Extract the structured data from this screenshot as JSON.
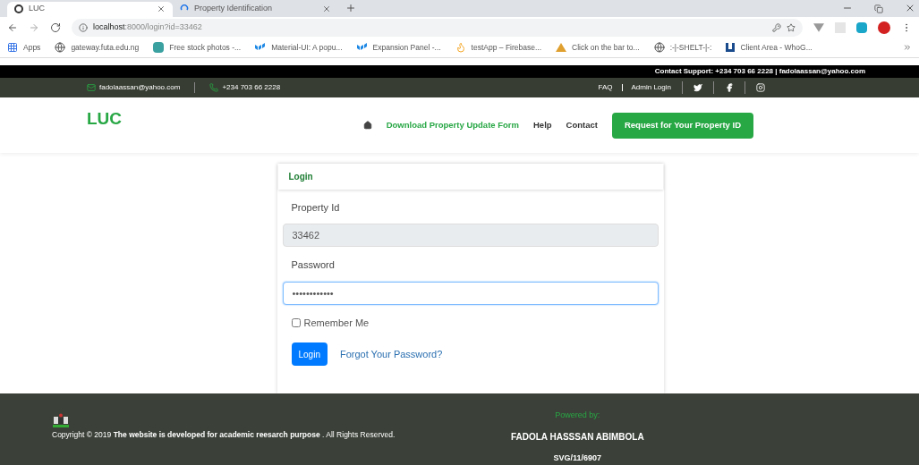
{
  "browser": {
    "tabs": [
      {
        "title": "LUC",
        "selected": true,
        "kind": "loaded"
      },
      {
        "title": "Property Identification",
        "selected": false,
        "kind": "loading"
      }
    ],
    "address": {
      "host": "localhost",
      "rest": ":8000/login?id=33462"
    },
    "bookmarks": [
      {
        "label": "Apps",
        "kind": "apps"
      },
      {
        "label": "gateway.futa.edu.ng",
        "kind": "globe"
      },
      {
        "label": "Free stock photos -...",
        "kind": "square"
      },
      {
        "label": "Material-UI: A popu...",
        "kind": "mui"
      },
      {
        "label": "Expansion Panel -...",
        "kind": "mui"
      },
      {
        "label": "testApp – Firebase...",
        "kind": "fire"
      },
      {
        "label": "Click on the bar to...",
        "kind": "tent"
      },
      {
        "label": ":-|-SHELT-|-:",
        "kind": "globe"
      },
      {
        "label": "Client Area - WhoG...",
        "kind": "whog"
      }
    ]
  },
  "support_strip": "Contact Support: +234 703 66 2228 | fadolaassan@yahoo.com",
  "top_bar": {
    "email": "fadolaassan@yahoo.com",
    "phone": "+234 703 66 2228",
    "links": [
      "FAQ",
      "Admin Login"
    ]
  },
  "navbar": {
    "brand": "LUC",
    "links": [
      {
        "label": "Download Property Update Form",
        "selected": true
      },
      {
        "label": "Help",
        "selected": false
      },
      {
        "label": "Contact",
        "selected": false
      }
    ],
    "cta": "Request for Your Property ID"
  },
  "login": {
    "title": "Login",
    "fields": [
      {
        "label": "Property Id",
        "value": "33462",
        "disabled": true,
        "focused": false
      },
      {
        "label": "Password",
        "value": "••••••••••••",
        "disabled": false,
        "focused": true
      }
    ],
    "remember": {
      "label": "Remember Me",
      "checked": false
    },
    "submit": "Login",
    "forgot": "Forgot Your Password?"
  },
  "footer": {
    "copyright_pre": "Copyright © 2019",
    "copyright_bold": "The website is developed for academic reesarch purpose",
    "copyright_post": ". All Rights Reserved.",
    "powered_label": "Powered by:",
    "author": "FADOLA HASSSAN ABIMBOLA",
    "author_id": "SVG/11/6907"
  }
}
